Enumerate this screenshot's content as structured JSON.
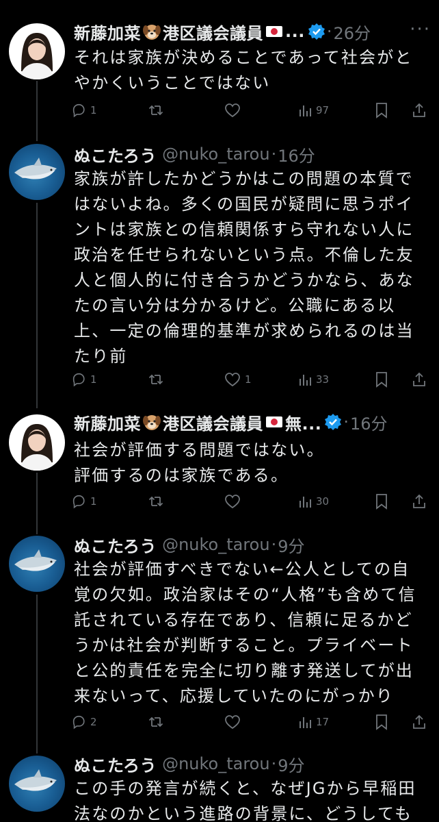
{
  "tweets": [
    {
      "name": "新藤加菜",
      "name_suffix": "港区議会議員",
      "name_tail": "...",
      "handle": "",
      "time": "26分",
      "lines": [
        "それは家族が決めることであって社会がと",
        "やかくいうことではない"
      ],
      "replies": "1",
      "retweets": "",
      "likes": "",
      "views": "97"
    },
    {
      "name": "ぬこたろう",
      "handle": "@nuko_tarou",
      "time": "16分",
      "lines": [
        "家族が許したかどうかはこの問題の本質で",
        "はないよね。多くの国民が疑問に思うポイ",
        "ントは家族との信頼関係すら守れない人に",
        "政治を任せられないという点。不倫した友",
        "人と個人的に付き合うかどうかなら、あな",
        "たの言い分は分かるけど。公職にある以",
        "上、一定の倫理的基準が求められるのは当",
        "たり前"
      ],
      "replies": "1",
      "retweets": "",
      "likes": "1",
      "views": "33"
    },
    {
      "name": "新藤加菜",
      "name_suffix": "港区議会議員",
      "name_tail": "無...",
      "handle": "",
      "time": "16分",
      "lines": [
        "社会が評価する問題ではない。",
        "評価するのは家族である。"
      ],
      "replies": "1",
      "retweets": "",
      "likes": "",
      "views": "30"
    },
    {
      "name": "ぬこたろう",
      "handle": "@nuko_tarou",
      "time": "9分",
      "lines": [
        "社会が評価すべきでない←公人としての自",
        "覚の欠如。政治家はその“人格”も含めて信",
        "託されている存在であり、信頼に足るかど",
        "うかは社会が判断すること。プライベート",
        "と公的責任を完全に切り離す発送してが出",
        "来ないって、応援していたのにがっかり"
      ],
      "replies": "2",
      "retweets": "",
      "likes": "",
      "views": "17"
    },
    {
      "name": "ぬこたろう",
      "handle": "@nuko_tarou",
      "time": "9分",
      "lines": [
        "この手の発言が続くと、なぜJGから早稲田",
        "法なのかという進路の背景に、どうしても"
      ],
      "replies": "",
      "retweets": "",
      "likes": "",
      "views": ""
    }
  ],
  "separator": "·",
  "colors": {
    "background": "#000000",
    "text": "#e7e9ea",
    "muted": "#71767b",
    "verified": "#1d9bf0"
  },
  "icons": [
    "more-icon",
    "reply-icon",
    "retweet-icon",
    "like-icon",
    "views-icon",
    "bookmark-icon",
    "share-icon",
    "verified-badge-icon",
    "dog-emoji-icon",
    "japan-flag-icon"
  ]
}
